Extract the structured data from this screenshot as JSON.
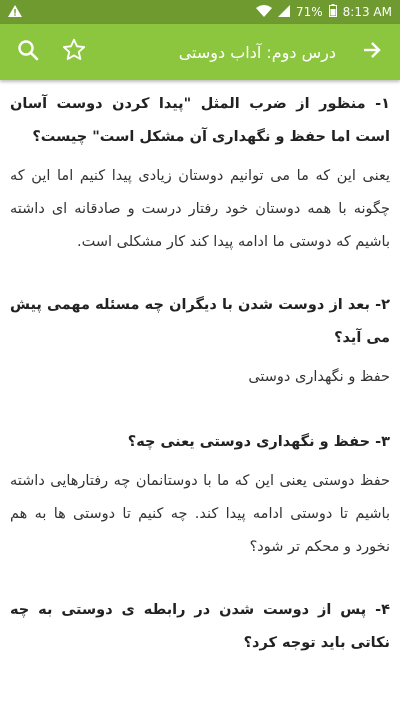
{
  "status_bar": {
    "battery": "71%",
    "time": "8:13 AM"
  },
  "header": {
    "title": "درس دوم: آداب دوستی"
  },
  "colors": {
    "accent": "#8cc63e",
    "status": "#6f9a2f"
  },
  "qa": [
    {
      "question": "۱- منظور از ضرب المثل \"پیدا کردن دوست آسان است اما حفظ و نگهداری آن مشکل است\" چیست؟",
      "answer": "یعنی این که ما می توانیم دوستان زیادی پیدا کنیم اما این که چگونه با همه دوستان خود رفتار درست و صادقانه ای داشته باشیم که دوستی ما ادامه پیدا کند کار مشکلی است."
    },
    {
      "question": "۲- بعد از دوست شدن با دیگران چه مسئله مهمی پیش می آید؟",
      "answer": "حفظ و نگهداری دوستی"
    },
    {
      "question": "۳- حفظ و نگهداری دوستی یعنی چه؟",
      "answer": "حفظ دوستی یعنی این که ما با دوستانمان چه رفتارهایی داشته باشیم تا دوستی ادامه پیدا کند. چه کنیم تا دوستی ها به هم نخورد و محکم تر شود؟"
    },
    {
      "question": "۴- پس از دوست شدن در رابطه ی دوستی به چه نکاتی باید توجه کرد؟"
    }
  ]
}
